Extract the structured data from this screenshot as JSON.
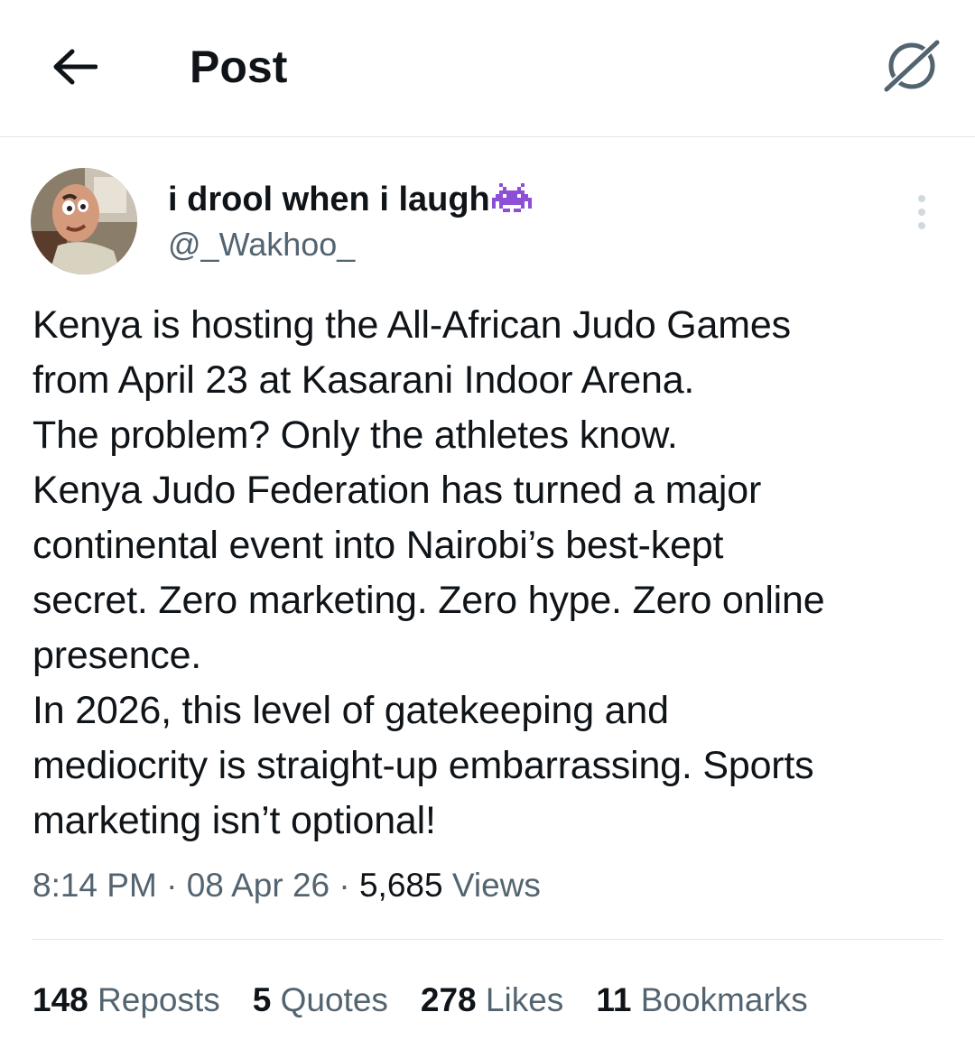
{
  "header": {
    "title": "Post",
    "back_icon": "arrow-left-icon",
    "grok_icon": "grok-icon"
  },
  "author": {
    "display_name": "i drool when i laugh",
    "emoji": "space-invader",
    "handle": "@_Wakhoo_"
  },
  "post": {
    "lines": [
      "Kenya is hosting the All-African Judo Games",
      "from April 23 at Kasarani Indoor Arena.",
      "The problem? Only the athletes know.",
      "Kenya Judo Federation has turned a major",
      "continental event into Nairobi’s best-kept",
      "secret. Zero marketing. Zero hype. Zero online",
      "presence.",
      "In 2026, this level of gatekeeping and",
      "mediocrity is straight-up embarrassing. Sports",
      "marketing isn’t optional!"
    ]
  },
  "meta": {
    "time": "8:14 PM",
    "separator": "·",
    "date": "08 Apr 26",
    "views_count": "5,685",
    "views_label": "Views"
  },
  "stats": {
    "reposts_count": "148",
    "reposts_label": "Reposts",
    "quotes_count": "5",
    "quotes_label": "Quotes",
    "likes_count": "278",
    "likes_label": "Likes",
    "bookmarks_count": "11",
    "bookmarks_label": "Bookmarks"
  },
  "colors": {
    "text_primary": "#0f1419",
    "text_secondary": "#536471",
    "divider": "#e6e6e6",
    "emoji_purple": "#8c4fd6"
  }
}
